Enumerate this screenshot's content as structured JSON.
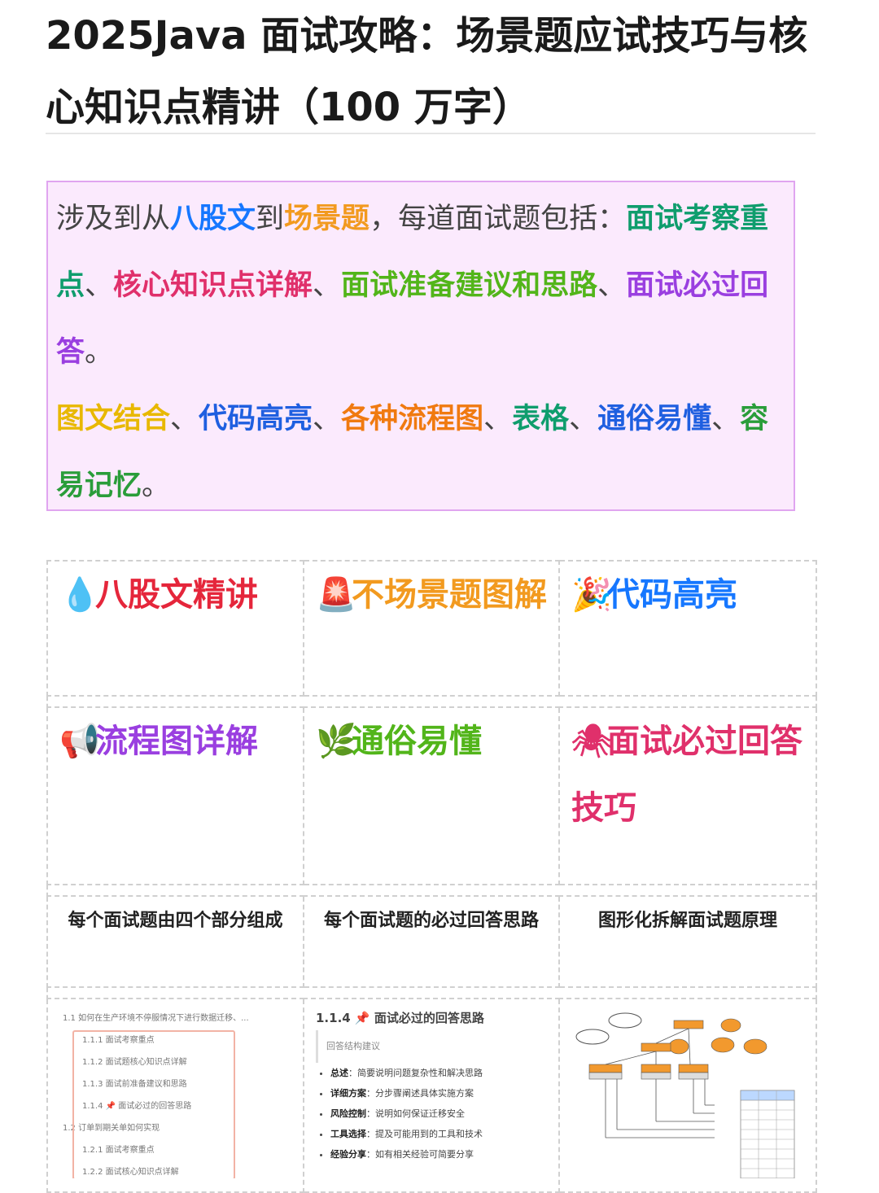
{
  "title": "2025Java 面试攻略：场景题应试技巧与核心知识点精讲（100 万字）",
  "intro": {
    "p1_a": "涉及到从",
    "p1_b": "八股文",
    "p1_c": "到",
    "p1_d": "场景题",
    "p1_e": "，每道面试题包括：",
    "p1_f": "面试考察重点",
    "p1_g": "、",
    "p1_h": "核心知识点详解",
    "p1_i": "、",
    "p1_j": "面试准备建议和思路",
    "p1_k": "、",
    "p1_l": "面试必过回答",
    "p1_m": "。",
    "p2_a": "图文结合",
    "p2_b": "、",
    "p2_c": "代码高亮",
    "p2_d": "、",
    "p2_e": "各种流程图",
    "p2_f": "、",
    "p2_g": "表格",
    "p2_h": "、",
    "p2_i": "通俗易懂",
    "p2_j": "、",
    "p2_k": "容易记忆",
    "p2_l": "。"
  },
  "features": [
    {
      "icon": "droplet-icon",
      "glyph": "💧",
      "label": "八股文精讲",
      "color": "#e5263b"
    },
    {
      "icon": "siren-icon",
      "glyph": "🚨",
      "label": "不场景题图解",
      "color": "#f29a1f"
    },
    {
      "icon": "confetti-icon",
      "glyph": "🎉",
      "label": "代码高亮",
      "color": "#1677ff"
    },
    {
      "icon": "megaphone-icon",
      "glyph": "📢",
      "label": "流程图详解",
      "color": "#9a3fe0"
    },
    {
      "icon": "leaf-icon",
      "glyph": "🌿",
      "label": "通俗易懂",
      "color": "#52b51a"
    },
    {
      "icon": "spider-icon",
      "glyph": "🕷",
      "label": "面试必过回答技巧",
      "color": "#e0306b"
    }
  ],
  "captions": [
    "每个面试题由四个部分组成",
    "每个面试题的必过回答思路",
    "图形化拆解面试题原理"
  ],
  "thumb_toc": [
    "1.1 如何在生产环境不停服情况下进行数据迁移、...",
    "1.1.1 面试考察重点",
    "1.1.2 面试题核心知识点详解",
    "1.1.3 面试前准备建议和思路",
    "1.1.4 📌 面试必过的回答思路",
    "1.2 订单到期关单如何实现",
    "1.2.1 面试考察重点",
    "1.2.2 面试核心知识点详解"
  ],
  "thumb_answer": {
    "heading": "1.1.4 📌 面试必过的回答思路",
    "quote": "回答结构建议",
    "items": [
      {
        "k": "总述",
        "v": "：简要说明问题复杂性和解决思路"
      },
      {
        "k": "详细方案",
        "v": "：分步骤阐述具体实施方案"
      },
      {
        "k": "风险控制",
        "v": "：说明如何保证迁移安全"
      },
      {
        "k": "工具选择",
        "v": "：提及可能用到的工具和技术"
      },
      {
        "k": "经验分享",
        "v": "：如有相关经验可简要分享"
      }
    ]
  },
  "colors": {
    "callout_bg": "#fbeafd",
    "callout_border": "#e0a5f0"
  }
}
